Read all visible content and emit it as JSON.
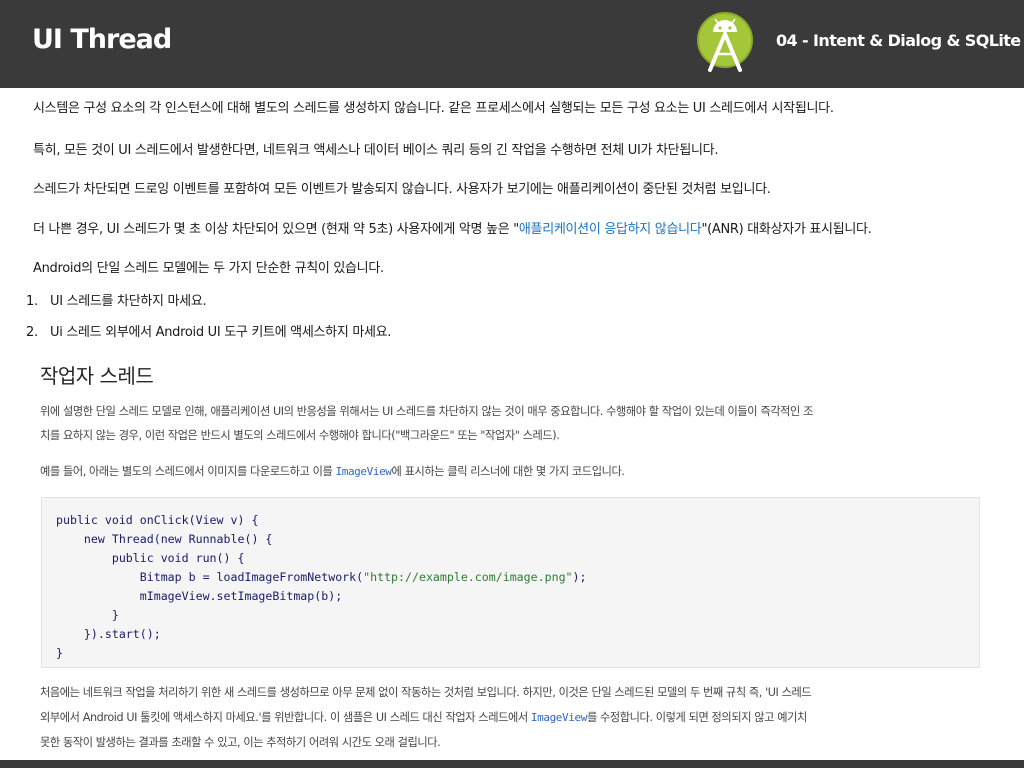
{
  "header": {
    "title": "UI Thread",
    "chapter": "04 - Intent & Dialog & SQLite",
    "logo_icon": "android-studio-icon"
  },
  "body": {
    "p1": "시스템은 구성 요소의 각 인스턴스에 대해 별도의 스레드를 생성하지 않습니다. 같은 프로세스에서 실행되는 모든 구성 요소는 UI 스레드에서 시작됩니다.",
    "p2": "특히, 모든 것이 UI 스레드에서 발생한다면, 네트워크 액세스나 데이터 베이스 쿼리 등의 긴 작업을 수행하면 전체 UI가 차단됩니다.",
    "p3": "스레드가 차단되면 드로잉 이벤트를 포함하여 모든 이벤트가 발송되지 않습니다. 사용자가 보기에는 애플리케이션이 중단된 것처럼 보입니다.",
    "p4_before": "더 나쁜 경우, UI 스레드가 몇 초 이상 차단되어 있으면 (현재 약 5초) 사용자에게 악명 높은 \"",
    "p4_link": "애플리케이션이 응답하지 않습니다",
    "p4_after": "\"(ANR) 대화상자가 표시됩니다.",
    "p5": "Android의 단일 스레드 모델에는 두 가지 단순한 규칙이 있습니다.",
    "rules": [
      {
        "num": "1.",
        "text": "UI 스레드를 차단하지 마세요."
      },
      {
        "num": "2.",
        "text": "Ui 스레드 외부에서 Android UI 도구 키트에 액세스하지 마세요."
      }
    ]
  },
  "doc": {
    "heading": "작업자 스레드",
    "t1": "위에 설명한 단일 스레드 모델로 인해, 애플리케이션 UI의 반응성을 위해서는 UI 스레드를 차단하지 않는 것이 매우 중요합니다. 수행해야 할 작업이 있는데 이들이 즉각적인 조",
    "t2": "치를 요하지 않는 경우, 이런 작업은 반드시 별도의 스레드에서 수행해야 합니다(\"백그라운드\" 또는 \"작업자\" 스레드).",
    "t3_before": "예를 들어, 아래는 별도의 스레드에서 이미지를 다운로드하고 이를 ",
    "t3_code": "ImageView",
    "t3_after": "에 표시하는 클릭 리스너에 대한 몇 가지 코드입니다.",
    "t4": "처음에는 네트워크 작업을 처리하기 위한 새 스레드를 생성하므로 아무 문제 없이 작동하는 것처럼 보입니다. 하지만, 이것은 단일 스레드된 모델의 두 번째 규칙 즉, 'UI 스레드",
    "t5": "외부에서 Android UI 툴킷에 액세스하지 마세요.'를 위반합니다. 이 샘플은 UI 스레드 대신 작업자 스레드에서 ",
    "t5_code": "ImageView",
    "t5_after": "를 수정합니다. 이렇게 되면 정의되지 않고 예기치",
    "t6": "못한 동작이 발생하는 결과를 초래할 수 있고, 이는 추적하기 어려워 시간도 오래 걸립니다."
  },
  "code": {
    "l1": "public void onClick(View v) {",
    "l2": "    new Thread(new Runnable() {",
    "l3": "        public void run() {",
    "l4_a": "            Bitmap b = loadImageFromNetwork(",
    "l4_s": "\"http://example.com/image.png\"",
    "l4_b": ");",
    "l5": "            mImageView.setImageBitmap(b);",
    "l6": "        }",
    "l7": "    }).start();",
    "l8": "}"
  },
  "colors": {
    "header_bg": "#3a3a3a",
    "link": "#1a73c8",
    "android_green": "#a4c639"
  }
}
